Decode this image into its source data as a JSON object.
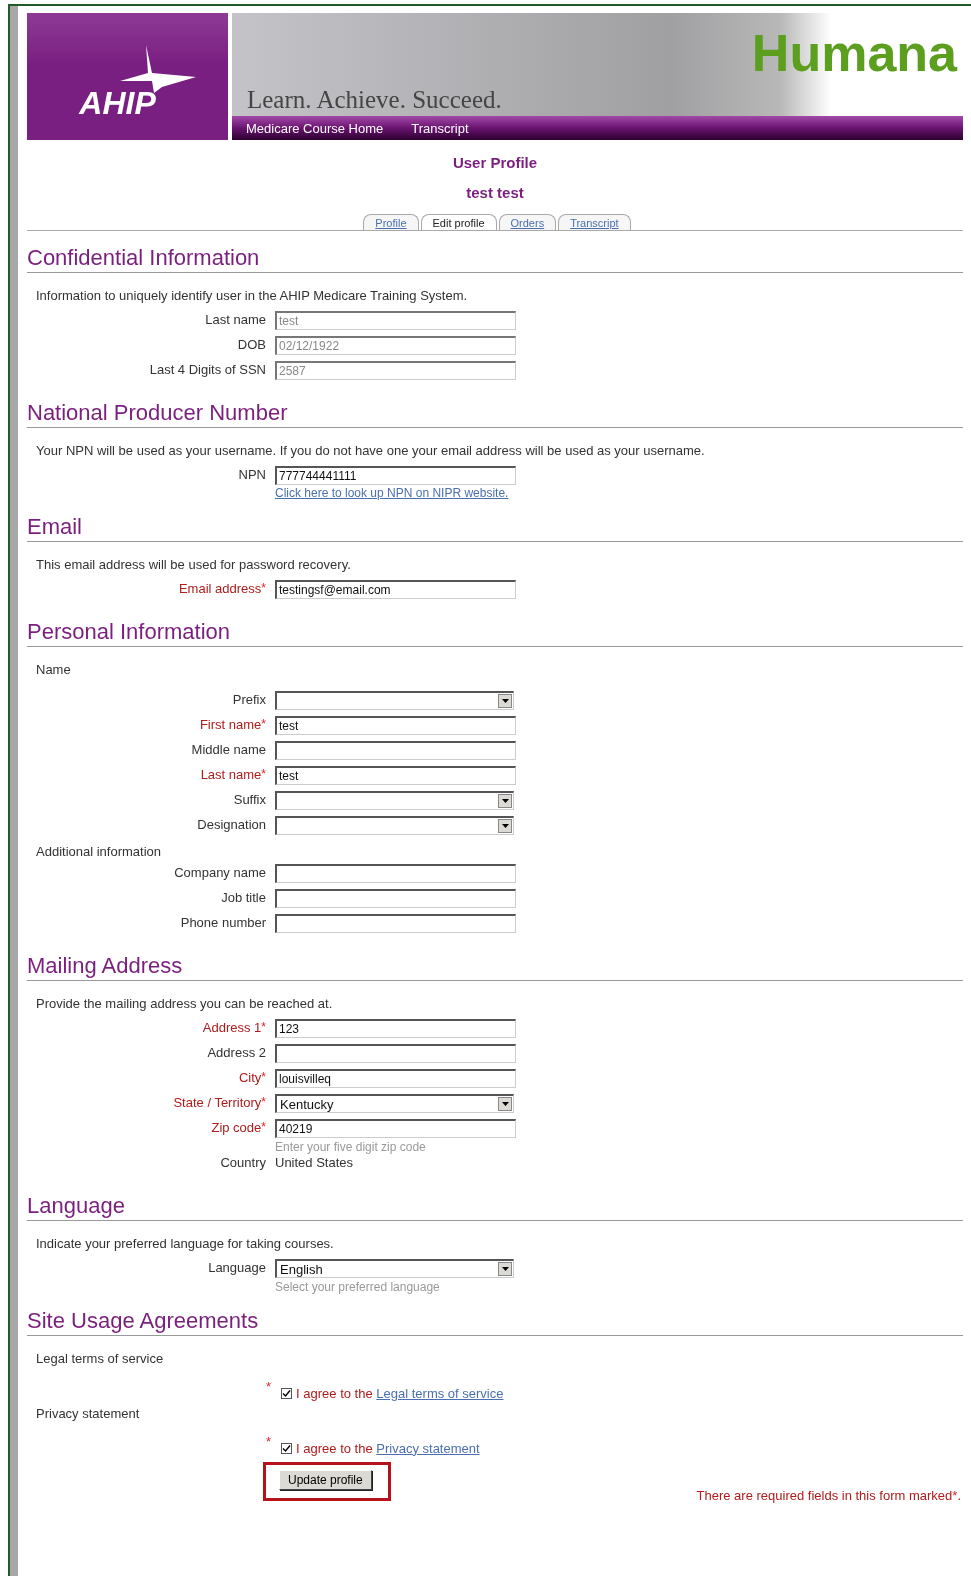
{
  "header": {
    "logo": "AHIP",
    "tagline": "Learn. Achieve. Succeed.",
    "brand": "Humana",
    "nav": [
      "Medicare Course Home",
      "Transcript"
    ]
  },
  "page_title": "User Profile",
  "user_name": "test test",
  "tabs": [
    {
      "label": "Profile",
      "selected": false
    },
    {
      "label": "Edit profile",
      "selected": true
    },
    {
      "label": "Orders",
      "selected": false
    },
    {
      "label": "Transcript",
      "selected": false
    }
  ],
  "sections": [
    {
      "heading": "Confidential Information",
      "items": [
        {
          "kind": "note",
          "text": "Information to uniquely identify user in the AHIP Medicare Training System."
        },
        {
          "kind": "text",
          "label": "Last name",
          "value": "test",
          "disabled": true
        },
        {
          "kind": "text",
          "label": "DOB",
          "value": "02/12/1922",
          "disabled": true
        },
        {
          "kind": "text",
          "label": "Last 4 Digits of SSN",
          "value": "2587",
          "disabled": true
        }
      ]
    },
    {
      "heading": "National Producer Number",
      "items": [
        {
          "kind": "note",
          "text": "Your NPN will be used as your username. If you do not have one your email address will be used as your username."
        },
        {
          "kind": "text",
          "label": "NPN",
          "value": "777744441111",
          "disabled": false,
          "link": "Click here to look up NPN on NIPR website."
        }
      ]
    },
    {
      "heading": "Email",
      "items": [
        {
          "kind": "note",
          "text": "This email address will be used for password recovery."
        },
        {
          "kind": "text",
          "label": "Email address",
          "mark": "*",
          "value": "testingsf@email.com",
          "disabled": false
        }
      ]
    },
    {
      "heading": "Personal Information",
      "items": [
        {
          "kind": "subhead",
          "text": "Name"
        },
        {
          "kind": "select",
          "label": "Prefix"
        },
        {
          "kind": "text",
          "label": "First name",
          "mark": "*",
          "value": "test",
          "disabled": false
        },
        {
          "kind": "text",
          "label": "Middle name",
          "disabled": false
        },
        {
          "kind": "text",
          "label": "Last name",
          "mark": "*",
          "value": "test",
          "disabled": false
        },
        {
          "kind": "select",
          "label": "Suffix"
        },
        {
          "kind": "select",
          "label": "Designation"
        },
        {
          "kind": "subhead",
          "text": "Additional information"
        },
        {
          "kind": "text",
          "label": "Company name",
          "disabled": false
        },
        {
          "kind": "text",
          "label": "Job title",
          "disabled": false
        },
        {
          "kind": "text",
          "label": "Phone number",
          "disabled": false
        }
      ]
    },
    {
      "heading": "Mailing Address",
      "items": [
        {
          "kind": "note",
          "text": "Provide the mailing address you can be reached at."
        },
        {
          "kind": "text",
          "label": "Address 1",
          "mark": "*",
          "value": "123",
          "disabled": false
        },
        {
          "kind": "text",
          "label": "Address 2",
          "disabled": false
        },
        {
          "kind": "text",
          "label": "City",
          "mark": "*",
          "value": "louisvilleq",
          "disabled": false
        },
        {
          "kind": "select",
          "label": "State / Territory",
          "mark": "*",
          "value": "Kentucky"
        },
        {
          "kind": "text",
          "label": "Zip code",
          "mark": "*",
          "value": "40219",
          "disabled": false,
          "hint": "Enter your five digit zip code"
        },
        {
          "kind": "static",
          "label": "Country",
          "value": "United States"
        }
      ]
    },
    {
      "heading": "Language",
      "items": [
        {
          "kind": "note",
          "text": "Indicate your preferred language for taking courses."
        },
        {
          "kind": "select",
          "label": "Language",
          "value": "English",
          "hint": "Select your preferred language"
        }
      ]
    },
    {
      "heading": "Site Usage Agreements",
      "items": [
        {
          "kind": "subhead",
          "text": "Legal terms of service"
        },
        {
          "kind": "agreement",
          "mark": "*",
          "checked": true,
          "text": "I agree to the",
          "link": "Legal terms of service"
        },
        {
          "kind": "subhead",
          "text": "Privacy statement"
        },
        {
          "kind": "agreement",
          "mark": "*",
          "checked": true,
          "text": "I agree to the",
          "link": "Privacy statement"
        }
      ]
    }
  ],
  "submit": "Update profile",
  "footer_note": {
    "text": "There are required fields in this form marked",
    "mark": "*",
    "end": "."
  }
}
